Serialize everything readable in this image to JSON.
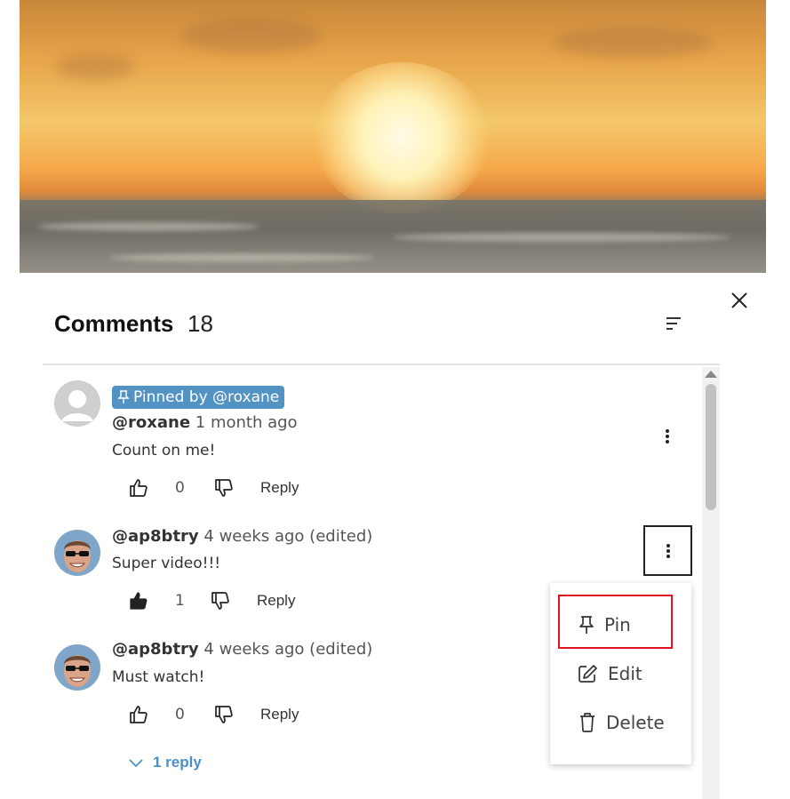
{
  "header": {
    "title": "Comments",
    "count": "18",
    "close_icon": "close-icon",
    "sort_icon": "sort-icon"
  },
  "comments": [
    {
      "pinned_label": "Pinned by @roxane",
      "username": "@roxane",
      "time": "1 month ago",
      "edited": "",
      "text": "Count on me!",
      "likes": "0",
      "reply_label": "Reply",
      "liked": false
    },
    {
      "pinned_label": "",
      "username": "@ap8btry",
      "time": "4 weeks ago",
      "edited": "(edited)",
      "text": "Super video!!!",
      "likes": "1",
      "reply_label": "Reply",
      "liked": true
    },
    {
      "pinned_label": "",
      "username": "@ap8btry",
      "time": "4 weeks ago",
      "edited": "(edited)",
      "text": "Must watch!",
      "likes": "0",
      "reply_label": "Reply",
      "liked": false,
      "replies_label": "1 reply"
    }
  ],
  "context_menu": {
    "items": [
      {
        "label": "Pin",
        "icon": "pin-icon"
      },
      {
        "label": "Edit",
        "icon": "edit-icon"
      },
      {
        "label": "Delete",
        "icon": "trash-icon"
      }
    ]
  },
  "colors": {
    "pin_badge": "#5393c4",
    "link": "#4a90c8",
    "highlight": "#e0141e"
  }
}
